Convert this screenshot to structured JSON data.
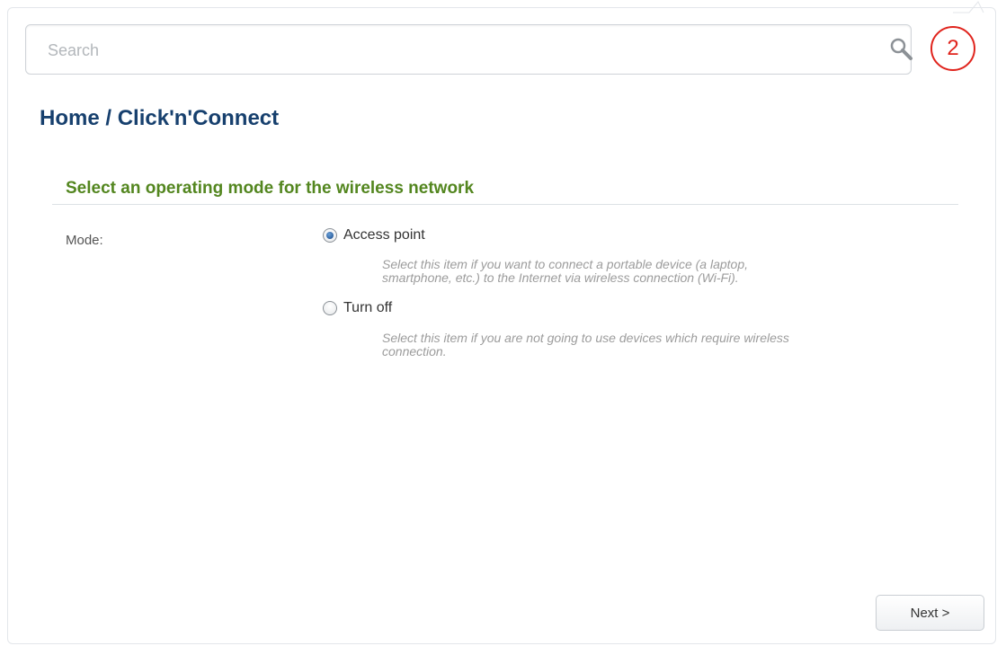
{
  "search": {
    "placeholder": "Search"
  },
  "step": {
    "number": "2",
    "accent_color": "#e0241d"
  },
  "breadcrumb": {
    "home": "Home",
    "separator": " / ",
    "current": "Click'n'Connect"
  },
  "section": {
    "title": "Select an operating mode for the wireless network"
  },
  "mode": {
    "label": "Mode:",
    "selected": "Access point",
    "options": [
      {
        "label": "Access point",
        "checked": true,
        "hint_line1": "Select this item if you want to connect a portable device (a laptop,",
        "hint_line2": "smartphone, etc.) to the Internet via wireless connection (Wi-Fi)."
      },
      {
        "label": "Turn off",
        "checked": false,
        "hint_line1": "Select this item if you are not going to use devices which require wireless",
        "hint_line2": "connection."
      }
    ]
  },
  "footer": {
    "next_label": "Next >"
  },
  "colors": {
    "breadcrumb": "#17406e",
    "section_title": "#53861f",
    "hint_text": "#9c9c9c"
  }
}
